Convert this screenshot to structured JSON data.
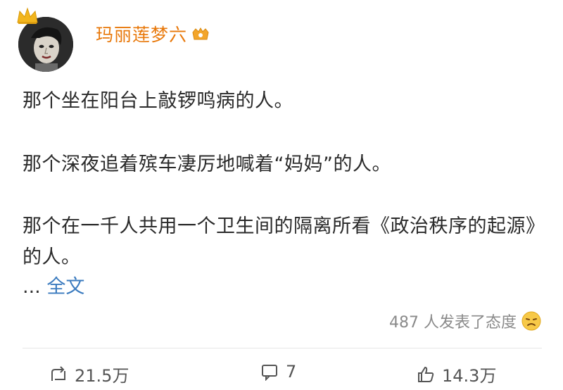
{
  "user": {
    "name": "玛丽莲梦六",
    "avatar_icon": "avatar",
    "crown_icon": "crown-icon",
    "badge_icon": "vip-badge-icon",
    "name_color": "#e8780a"
  },
  "post": {
    "paragraphs": [
      "那个坐在阳台上敲锣鸣病的人。",
      "那个深夜追着殡车凄厉地喊着“妈妈”的人。",
      "那个在一千人共用一个卫生间的隔离所看《政治秩序的起源》的人。"
    ],
    "ellipsis": "...",
    "full_text_link": "全文",
    "link_color": "#3b7bbf"
  },
  "reactions": {
    "text": "487 人发表了态度",
    "emoji_icon": "emoji-icon"
  },
  "actions": {
    "repost": {
      "icon": "repost-icon",
      "count": "21.5万"
    },
    "comment": {
      "icon": "comment-icon",
      "count": "7"
    },
    "like": {
      "icon": "like-icon",
      "count": "14.3万"
    }
  }
}
